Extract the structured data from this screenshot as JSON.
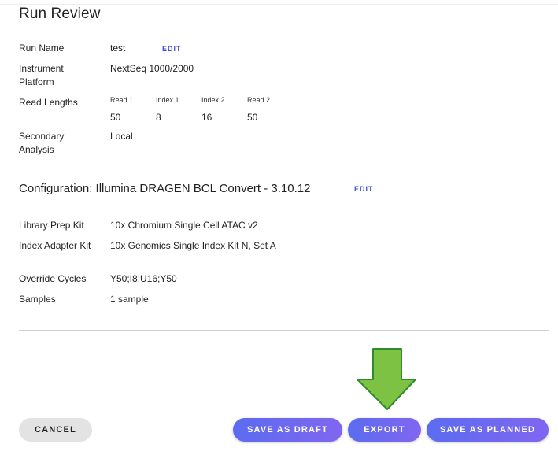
{
  "page_title": "Run Review",
  "run": {
    "run_name_label": "Run Name",
    "run_name_value": "test",
    "edit_label": "EDIT",
    "instrument_label": "Instrument Platform",
    "instrument_value": "NextSeq 1000/2000",
    "read_lengths_label": "Read Lengths",
    "read_lengths": [
      {
        "name": "Read 1",
        "value": "50"
      },
      {
        "name": "Index 1",
        "value": "8"
      },
      {
        "name": "Index 2",
        "value": "16"
      },
      {
        "name": "Read 2",
        "value": "50"
      }
    ],
    "secondary_label": "Secondary Analysis",
    "secondary_value": "Local"
  },
  "configuration": {
    "title": "Configuration: Illumina DRAGEN BCL Convert - 3.10.12",
    "edit_label": "EDIT",
    "library_prep_label": "Library Prep Kit",
    "library_prep_value": "10x Chromium Single Cell ATAC v2",
    "index_adapter_label": "Index Adapter Kit",
    "index_adapter_value": "10x Genomics Single Index Kit N, Set A",
    "override_label": "Override Cycles",
    "override_value": "Y50;I8;U16;Y50",
    "samples_label": "Samples",
    "samples_value": "1 sample"
  },
  "actions": {
    "cancel": "CANCEL",
    "save_draft": "SAVE AS DRAFT",
    "export": "EXPORT",
    "save_planned": "SAVE AS PLANNED"
  },
  "colors": {
    "accent": "#3d4fd1",
    "button_gradient_start": "#5b6cf0",
    "button_gradient_end": "#8166f0",
    "arrow_fill": "#7dc242",
    "arrow_stroke": "#2e8b2e"
  },
  "icons": {
    "pointer_arrow": "down-arrow-icon"
  }
}
